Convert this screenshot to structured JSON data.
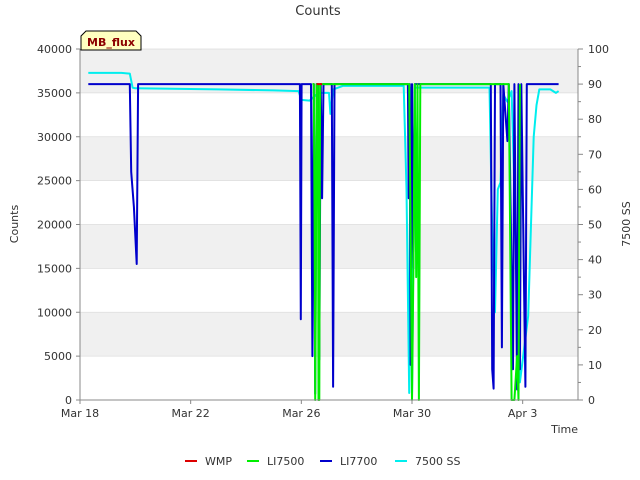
{
  "chart_data": {
    "type": "line",
    "title": "Counts",
    "xlabel": "Time",
    "ylabel": "Counts",
    "y2label": "7500 SS",
    "badge": "MB_flux",
    "x_tick_labels": [
      "Mar 18",
      "Mar 22",
      "Mar 26",
      "Mar 30",
      "Apr 3"
    ],
    "x_tick_days": [
      0,
      4,
      8,
      12,
      16
    ],
    "x_range_days": [
      0,
      18
    ],
    "y_ticks": [
      0,
      5000,
      10000,
      15000,
      20000,
      25000,
      30000,
      35000,
      40000
    ],
    "ylim": [
      0,
      40000
    ],
    "y2_ticks": [
      0,
      10,
      20,
      30,
      40,
      50,
      60,
      70,
      80,
      90,
      100
    ],
    "y2lim": [
      0,
      100
    ],
    "grid": "horizontal bands",
    "legend_position": "bottom",
    "series": [
      {
        "name": "WMP",
        "color": "#dd0000",
        "axis": "left",
        "points": [
          [
            8.55,
            36000
          ],
          [
            8.75,
            36000
          ]
        ]
      },
      {
        "name": "LI7500",
        "color": "#00ee00",
        "axis": "left",
        "points": [
          [
            8.4,
            36000
          ],
          [
            8.45,
            36000
          ],
          [
            8.48,
            20000
          ],
          [
            8.5,
            0
          ],
          [
            8.52,
            10000
          ],
          [
            8.55,
            36000
          ],
          [
            8.6,
            36000
          ],
          [
            8.62,
            0
          ],
          [
            8.65,
            0
          ],
          [
            8.68,
            36000
          ],
          [
            11.9,
            36000
          ],
          [
            11.95,
            20000
          ],
          [
            12.0,
            0
          ],
          [
            12.05,
            15000
          ],
          [
            12.1,
            36000
          ],
          [
            12.15,
            14000
          ],
          [
            12.2,
            36000
          ],
          [
            12.25,
            0
          ],
          [
            12.3,
            36000
          ],
          [
            15.2,
            36000
          ],
          [
            15.5,
            36000
          ],
          [
            15.6,
            0
          ],
          [
            15.7,
            0
          ],
          [
            15.8,
            5000
          ],
          [
            15.85,
            0
          ],
          [
            15.9,
            36000
          ]
        ]
      },
      {
        "name": "LI7700",
        "color": "#0000cc",
        "axis": "left",
        "points": [
          [
            0.3,
            36000
          ],
          [
            1.8,
            36000
          ],
          [
            1.85,
            26000
          ],
          [
            1.95,
            22000
          ],
          [
            2.05,
            15500
          ],
          [
            2.1,
            36000
          ],
          [
            2.2,
            36000
          ],
          [
            7.95,
            36000
          ],
          [
            7.98,
            9200
          ],
          [
            8.01,
            36000
          ],
          [
            8.35,
            36000
          ],
          [
            8.4,
            5000
          ],
          [
            8.45,
            36000
          ],
          [
            8.5,
            700
          ],
          [
            8.55,
            36000
          ],
          [
            8.6,
            36000
          ],
          [
            8.65,
            4600
          ],
          [
            8.7,
            36000
          ],
          [
            8.75,
            23000
          ],
          [
            8.8,
            36000
          ],
          [
            9.0,
            36000
          ],
          [
            9.1,
            36000
          ],
          [
            9.15,
            1500
          ],
          [
            9.2,
            36000
          ],
          [
            11.85,
            36000
          ],
          [
            11.88,
            23000
          ],
          [
            11.92,
            36000
          ],
          [
            11.95,
            4000
          ],
          [
            12.0,
            36000
          ],
          [
            12.05,
            15000
          ],
          [
            12.1,
            36000
          ],
          [
            14.85,
            36000
          ],
          [
            14.9,
            3500
          ],
          [
            14.95,
            1300
          ],
          [
            15.0,
            36000
          ],
          [
            15.2,
            36000
          ],
          [
            15.25,
            6000
          ],
          [
            15.3,
            36000
          ],
          [
            15.45,
            29500
          ],
          [
            15.5,
            36000
          ],
          [
            15.65,
            3500
          ],
          [
            15.7,
            36000
          ],
          [
            15.8,
            1200
          ],
          [
            15.85,
            36000
          ],
          [
            15.9,
            3500
          ],
          [
            15.95,
            36000
          ],
          [
            16.1,
            1500
          ],
          [
            16.15,
            36000
          ],
          [
            17.3,
            36000
          ]
        ]
      },
      {
        "name": "7500 SS",
        "color": "#00eeee",
        "axis": "right",
        "points": [
          [
            0.3,
            93.2
          ],
          [
            1.5,
            93.2
          ],
          [
            1.8,
            93.0
          ],
          [
            1.9,
            89.0
          ],
          [
            2.0,
            88.8
          ],
          [
            5.0,
            88.5
          ],
          [
            7.0,
            88.2
          ],
          [
            7.9,
            88.0
          ],
          [
            8.0,
            85.5
          ],
          [
            8.3,
            85.3
          ],
          [
            8.4,
            86.0
          ],
          [
            8.6,
            87.5
          ],
          [
            8.8,
            87.5
          ],
          [
            9.0,
            87.5
          ],
          [
            9.05,
            81.5
          ],
          [
            9.15,
            88.5
          ],
          [
            9.5,
            89.5
          ],
          [
            11.7,
            89.5
          ],
          [
            11.8,
            60.0
          ],
          [
            11.9,
            2.0
          ],
          [
            11.95,
            89.0
          ],
          [
            12.0,
            0.5
          ],
          [
            12.1,
            89.0
          ],
          [
            12.3,
            89.0
          ],
          [
            14.8,
            89.0
          ],
          [
            14.9,
            48.0
          ],
          [
            15.0,
            25.0
          ],
          [
            15.1,
            60.0
          ],
          [
            15.2,
            62.0
          ],
          [
            15.3,
            87.0
          ],
          [
            15.45,
            85.0
          ],
          [
            15.6,
            88.0
          ],
          [
            15.9,
            5.0
          ],
          [
            16.2,
            24.0
          ],
          [
            16.4,
            75.0
          ],
          [
            16.5,
            84.0
          ],
          [
            16.6,
            88.5
          ],
          [
            17.0,
            88.5
          ],
          [
            17.2,
            87.5
          ],
          [
            17.3,
            88.0
          ]
        ]
      }
    ]
  }
}
